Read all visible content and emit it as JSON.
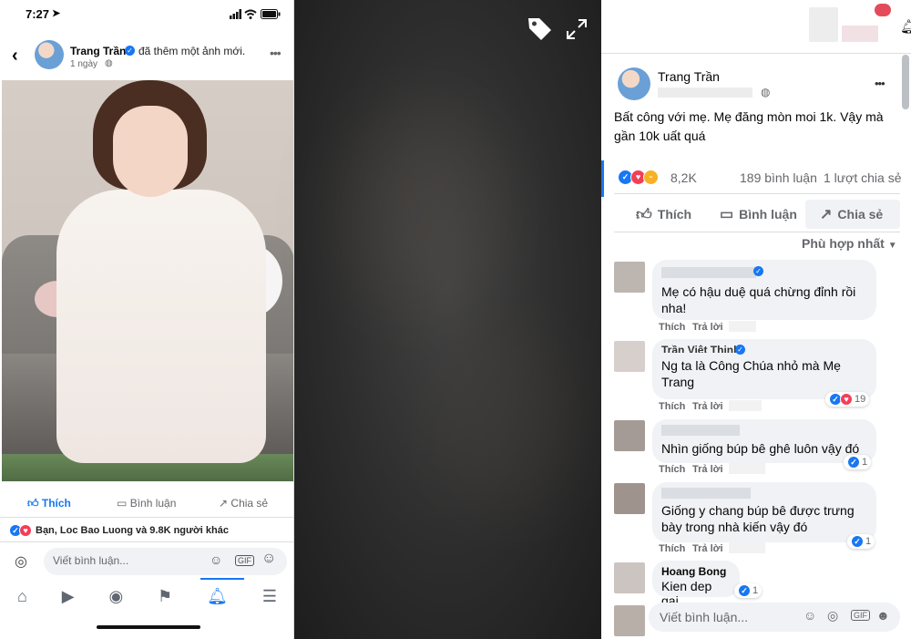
{
  "phone": {
    "time": "7:27",
    "author": "Trang Trần",
    "action": "đã thêm một ảnh mới.",
    "time_ago": "1 ngày",
    "like_label": "Thích",
    "comment_label": "Bình luận",
    "share_label": "Chia sẻ",
    "reactions_summary": "Bạn, Loc Bao Luong và 9.8K người khác",
    "comment_placeholder": "Viết bình luận...",
    "gif_label": "GIF"
  },
  "post": {
    "author": "Trang Trần",
    "more": "•••",
    "caption": "Bất công với mẹ. Mẹ đăng mòn moi 1k. Vậy mà gần 10k uất quá",
    "reaction_count": "8,2K",
    "comment_count": "189 bình luận",
    "share_count": "1 lượt chia sẻ",
    "like_label": "Thích",
    "comment_label": "Bình luận",
    "share_label": "Chia sẻ",
    "sort_label": "Phù hợp nhất"
  },
  "comments": [
    {
      "text": "Mẹ có hậu duệ quá chừng đỉnh rồi nha!",
      "like": "Thích",
      "reply": "Trả lời",
      "reactions": ""
    },
    {
      "name": "Trần Việt Thịnh",
      "text": "Ng ta là Công Chúa nhỏ mà Mẹ Trang",
      "like": "Thích",
      "reply": "Trả lời",
      "reactions": "19"
    },
    {
      "text": "Nhìn giống búp bê ghê luôn vậy đó",
      "like": "Thích",
      "reply": "Trả lời",
      "reactions": "1"
    },
    {
      "text": "Giống y chang búp bê được trưng bày trong nhà kiến vậy đó",
      "like": "Thích",
      "reply": "Trả lời",
      "reactions": "1"
    },
    {
      "name": "Hoang Bong",
      "text": "Kien dep gai",
      "reactions": "1"
    }
  ],
  "write_comment": {
    "placeholder": "Viết bình luận...",
    "gif": "GIF"
  },
  "colors": {
    "facebook_blue": "#1877f2",
    "heart_red": "#f33e58",
    "haha_yellow": "#f7b125"
  }
}
